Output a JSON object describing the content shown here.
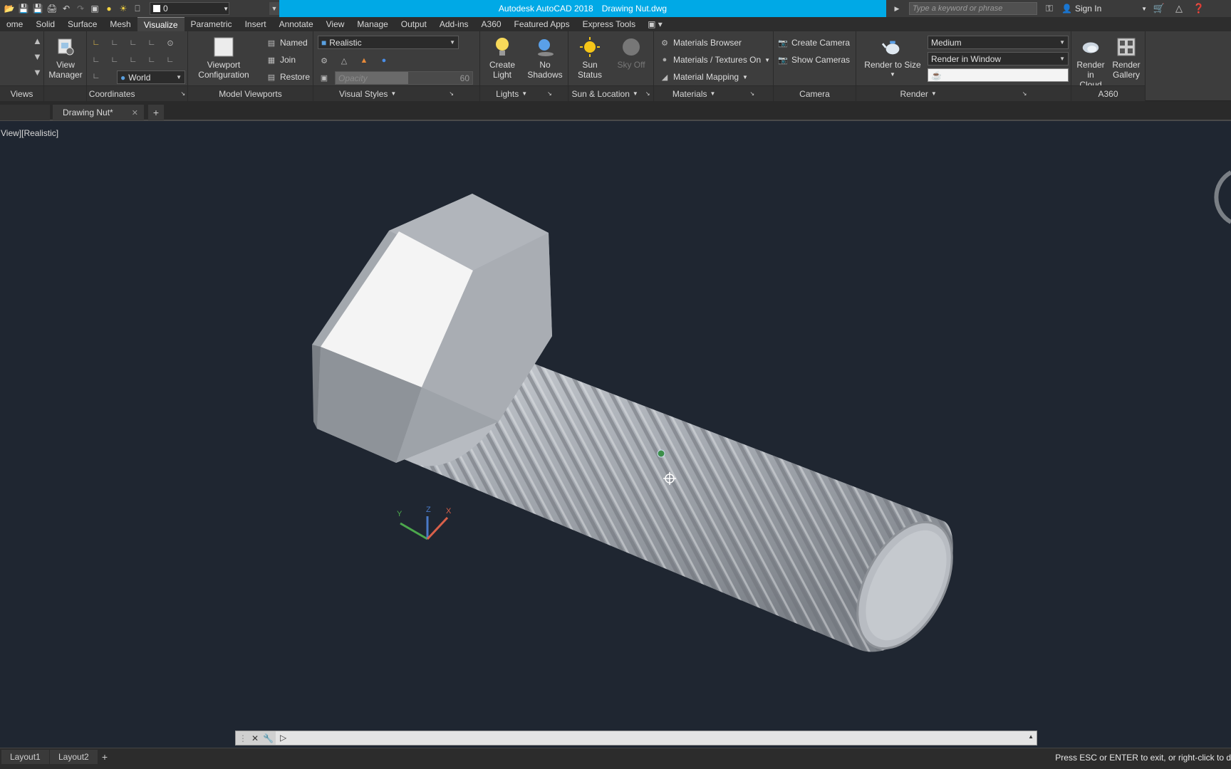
{
  "title": {
    "app": "Autodesk AutoCAD 2018",
    "file": "Drawing Nut.dwg",
    "layer": "0",
    "search_placeholder": "Type a keyword or phrase",
    "sign_in": "Sign In"
  },
  "menu": {
    "tabs": [
      "ome",
      "Solid",
      "Surface",
      "Mesh",
      "Visualize",
      "Parametric",
      "Insert",
      "Annotate",
      "View",
      "Manage",
      "Output",
      "Add-ins",
      "A360",
      "Featured Apps",
      "Express Tools"
    ],
    "active": "Visualize"
  },
  "ribbon": {
    "views": {
      "title": "Views",
      "view_manager": "View\nManager"
    },
    "coordinates": {
      "title": "Coordinates",
      "ucs": "World"
    },
    "model_viewports": {
      "title": "Model Viewports",
      "viewport_config": "Viewport\nConfiguration",
      "named": "Named",
      "join": "Join",
      "restore": "Restore"
    },
    "visual_styles": {
      "title": "Visual Styles",
      "style": "Realistic",
      "opacity_label": "Opacity",
      "opacity_value": "60"
    },
    "lights": {
      "title": "Lights",
      "create_light": "Create\nLight",
      "no_shadows": "No\nShadows"
    },
    "sun_location": {
      "title": "Sun & Location",
      "sun_status": "Sun\nStatus",
      "sky_off": "Sky Off"
    },
    "materials": {
      "title": "Materials",
      "browser": "Materials Browser",
      "textures": "Materials / Textures On",
      "mapping": "Material Mapping"
    },
    "camera": {
      "title": "Camera",
      "create": "Create Camera",
      "show": "Show  Cameras"
    },
    "render": {
      "title": "Render",
      "render_to_size": "Render to Size",
      "quality": "Medium",
      "target": "Render in Window"
    },
    "a360": {
      "title": "A360",
      "cloud": "Render in\nCloud",
      "gallery": "Render\nGallery"
    }
  },
  "doc_tab": {
    "name": "Drawing Nut*"
  },
  "viewport": {
    "label": "View][Realistic]"
  },
  "ucs_icon": {
    "x": "X",
    "y": "Y",
    "z": "Z"
  },
  "layouts": [
    "Layout1",
    "Layout2"
  ],
  "status": {
    "message": "Press ESC or ENTER to exit, or right-click to d"
  }
}
